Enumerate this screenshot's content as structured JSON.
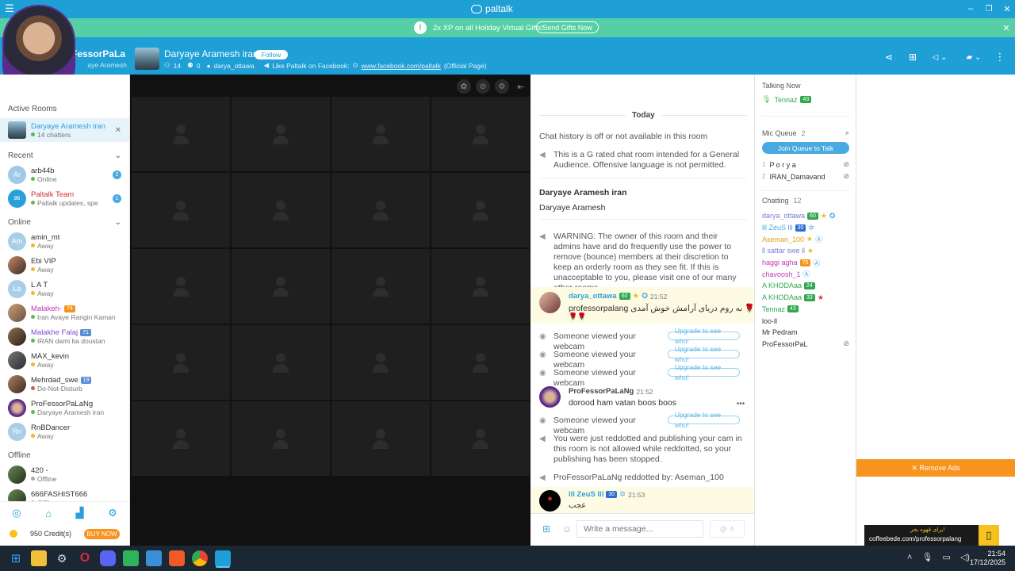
{
  "app": {
    "title": "paltalk"
  },
  "promo": {
    "text": "2x XP on all Holiday Virtual Gifts!",
    "button": "Send Gifts Now"
  },
  "profile": {
    "name": "ProFessorPaLaNg",
    "room": "Daryaye Aramesh"
  },
  "room": {
    "name": "Daryaye Aramesh iran",
    "follow": "Follow",
    "count_users": "14",
    "count_other": "0",
    "owner": "darya_ottawa",
    "like_text": "Like Paltalk on Facebook:",
    "fb_link": "www.facebook.com/paltalk",
    "fb_suffix": "(Official Page)"
  },
  "sidebar": {
    "active_label": "Active Rooms",
    "active_room": {
      "name": "Daryaye Aramesh iran",
      "sub": "14 chatters"
    },
    "recent_label": "Recent",
    "recent": [
      {
        "initials": "Ar",
        "name": "arb44b",
        "status": "Online",
        "badge": "2",
        "color": "#9fc9e8"
      },
      {
        "initials": "",
        "name": "Paltalk Team",
        "status": "Paltalk updates, spe",
        "badge": "1",
        "color": "#2aa0da"
      }
    ],
    "online_label": "Online",
    "online": [
      {
        "initials": "Am",
        "name": "amin_mt",
        "status": "Away",
        "color": "#a9cfe8",
        "gem": ""
      },
      {
        "initials": "",
        "name": "Ebi VIP",
        "status": "Away",
        "color": "",
        "gem": ""
      },
      {
        "initials": "La",
        "name": "L A T",
        "status": "Away",
        "color": "#a9cfe8",
        "gem": ""
      },
      {
        "initials": "",
        "name": "Malakeh-",
        "status": "Iran Avaye Rangin Kaman",
        "color": "",
        "gem": "74"
      },
      {
        "initials": "",
        "name": "Malakhe Falaj",
        "status": "IRAN dami ba doustan",
        "color": "",
        "gem": "71"
      },
      {
        "initials": "",
        "name": "MAX_kevin",
        "status": "Away",
        "color": "",
        "gem": ""
      },
      {
        "initials": "",
        "name": "Mehrdad_swe",
        "status": "Do-Not-Disturb",
        "color": "",
        "gem": "19"
      },
      {
        "initials": "",
        "name": "ProFessorPaLaNg",
        "status": "Daryaye Aramesh iran",
        "color": "",
        "gem": ""
      },
      {
        "initials": "Rn",
        "name": "RnBDancer",
        "status": "Away",
        "color": "#a9cfe8",
        "gem": ""
      }
    ],
    "offline_label": "Offline",
    "offline": [
      {
        "name": "420 -",
        "status": "Offline"
      },
      {
        "name": "666FASHIST666",
        "status": "Offline"
      }
    ],
    "credits": "950 Credit(s)",
    "buy": "BUY NOW"
  },
  "chat": {
    "day": "Today",
    "history_off": "Chat history is off or not available in this room",
    "rating": "This is a G rated chat room intended for a General Audience. Offensive language is not permitted.",
    "room_title": "Daryaye Aramesh iran",
    "room_desc": "Daryaye Aramesh",
    "warning": "WARNING: The owner of this room and their admins have and do frequently use the power to remove (bounce) members at their discretion to keep an orderly room as they see fit. If this is unacceptable to you, please visit one of our many other rooms.",
    "msg1": {
      "user": "darya_ottawa",
      "gem": "60",
      "time": "21:52",
      "text1": "professorpalang به روم دریای آرامش خوش آمدی 🌹",
      "text2": "🌹🌹"
    },
    "viewed": "Someone viewed your webcam",
    "upgrade": "Upgrade to see who!",
    "msg2": {
      "user": "ProFessorPaLaNg",
      "time": "21:52",
      "text": "dorood ham vatan boos boos"
    },
    "redot": "You were just reddotted and publishing your cam in this room is not allowed while reddotted, so your publishing has been stopped.",
    "redot_by": "ProFessorPaLaNg reddotted by: Aseman_100",
    "msg3": {
      "user": "lll ZeuS lll",
      "gem": "30",
      "time": "21:53",
      "text": "عجب"
    },
    "input_placeholder": "Write a message..."
  },
  "users": {
    "talking_label": "Talking Now",
    "talking": {
      "name": "Tennaz",
      "gem": "43"
    },
    "queue_label": "Mic Queue",
    "queue_count": "2",
    "join_btn": "Join Queue to Talk",
    "queue": [
      {
        "n": "1",
        "name": "P o r y a"
      },
      {
        "n": "2",
        "name": "IRAN_Damavand"
      }
    ],
    "chatting_label": "Chatting",
    "chatting_count": "12",
    "chatting": [
      {
        "name": "darya_ottawa",
        "color": "#7a7fd6",
        "gem": "60"
      },
      {
        "name": "lll ZeuS lll",
        "color": "#4aa9e0",
        "gem": "30"
      },
      {
        "name": "Aseman_100",
        "color": "#e0a21e",
        "gem": ""
      },
      {
        "name": "ll sattar swe ll",
        "color": "#7a7fd6",
        "gem": ""
      },
      {
        "name": "haggi agha",
        "color": "#c038b5",
        "gem": "76"
      },
      {
        "name": "chavoosh_1",
        "color": "#c038b5",
        "gem": ""
      },
      {
        "name": "A KHODAaa",
        "color": "#2fa84f",
        "gem": "24"
      },
      {
        "name": "A KHODAaa",
        "color": "#2fa84f",
        "gem": "33"
      },
      {
        "name": "Tennaz",
        "color": "#2fa84f",
        "gem": "43"
      },
      {
        "name": "loo-ll",
        "color": "#333",
        "gem": ""
      },
      {
        "name": "Mr Pedram",
        "color": "#333",
        "gem": ""
      },
      {
        "name": "ProFessorPaLaNg",
        "color": "#333",
        "gem": ""
      }
    ]
  },
  "ads": {
    "remove": "✕ Remove Ads",
    "banner_top": "برای قهوه بخر!",
    "banner_url": "coffeebede.com/professorpalang"
  },
  "taskbar": {
    "time": "21:54",
    "date": "17/12/2025"
  },
  "colors": {
    "brand": "#1e9fd6",
    "promo": "#56cfa6",
    "ad_orange": "#f7941d",
    "buy": "#f7941d"
  }
}
